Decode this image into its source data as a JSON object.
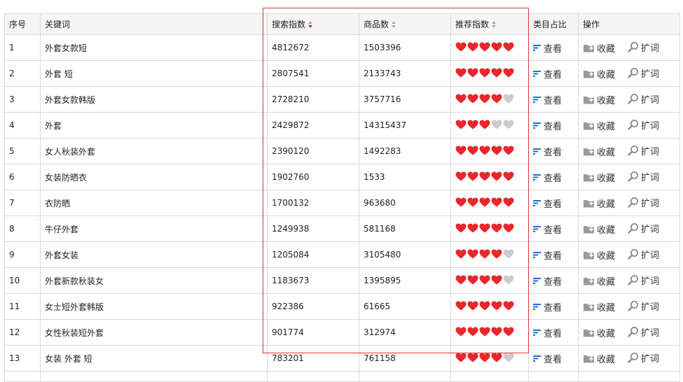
{
  "headers": {
    "index": "序号",
    "keyword": "关键词",
    "search_index": "搜索指数",
    "product_count": "商品数",
    "recommend_index": "推荐指数",
    "category_ratio": "类目占比",
    "actions": "操作"
  },
  "actions": {
    "view": "查看",
    "favorite": "收藏",
    "expand": "扩词"
  },
  "colors": {
    "heart_on": "#e8272c",
    "heart_off": "#cccccc",
    "highlight_border": "#dd3333",
    "view_icon": "#1f6fcf"
  },
  "rows": [
    {
      "index": "1",
      "keyword": "外套女款短",
      "search": "4812672",
      "products": "1503396",
      "rating": 5
    },
    {
      "index": "2",
      "keyword": "外套 短",
      "search": "2807541",
      "products": "2133743",
      "rating": 5
    },
    {
      "index": "3",
      "keyword": "外套女款韩版",
      "search": "2728210",
      "products": "3757716",
      "rating": 4
    },
    {
      "index": "4",
      "keyword": "外套",
      "search": "2429872",
      "products": "14315437",
      "rating": 3
    },
    {
      "index": "5",
      "keyword": "女人秋装外套",
      "search": "2390120",
      "products": "1492283",
      "rating": 5
    },
    {
      "index": "6",
      "keyword": "女装防晒衣",
      "search": "1902760",
      "products": "1533",
      "rating": 5
    },
    {
      "index": "7",
      "keyword": "衣防晒",
      "search": "1700132",
      "products": "963680",
      "rating": 5
    },
    {
      "index": "8",
      "keyword": "牛仔外套",
      "search": "1249938",
      "products": "581168",
      "rating": 5
    },
    {
      "index": "9",
      "keyword": "外套女装",
      "search": "1205084",
      "products": "3105480",
      "rating": 4
    },
    {
      "index": "10",
      "keyword": "外套新款秋装女",
      "search": "1183673",
      "products": "1395895",
      "rating": 4
    },
    {
      "index": "11",
      "keyword": "女士短外套韩版",
      "search": "922386",
      "products": "61665",
      "rating": 5
    },
    {
      "index": "12",
      "keyword": "女性秋装短外套",
      "search": "901774",
      "products": "312974",
      "rating": 5
    },
    {
      "index": "13",
      "keyword": "女装 外套 短",
      "search": "783201",
      "products": "761158",
      "rating": 4
    }
  ]
}
